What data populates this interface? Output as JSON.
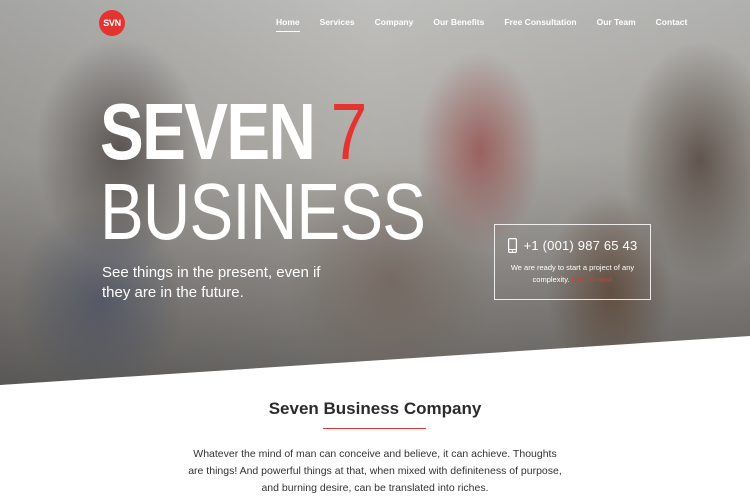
{
  "brand": {
    "logo_text": "SVN",
    "accent_color": "#e5342f"
  },
  "nav": {
    "items": [
      {
        "label": "Home",
        "active": true
      },
      {
        "label": "Services"
      },
      {
        "label": "Company"
      },
      {
        "label": "Our Benefits"
      },
      {
        "label": "Free Consultation"
      },
      {
        "label": "Our Team"
      },
      {
        "label": "Contact"
      }
    ]
  },
  "hero": {
    "title_word": "SEVEN",
    "title_number": "7",
    "title_line2": "BUSINESS",
    "tagline": "See things in the present, even if they are in the future."
  },
  "contact": {
    "icon": "phone-icon",
    "phone": "+1 (001) 987 65 43",
    "text": "We are ready to start a project of any complexity.",
    "link": "Call us now!"
  },
  "section": {
    "title": "Seven Business Company",
    "body": "Whatever the mind of man can conceive and believe, it can achieve. Thoughts are things! And powerful things at that, when mixed with definiteness of purpose, and burning desire, can be translated into riches."
  }
}
